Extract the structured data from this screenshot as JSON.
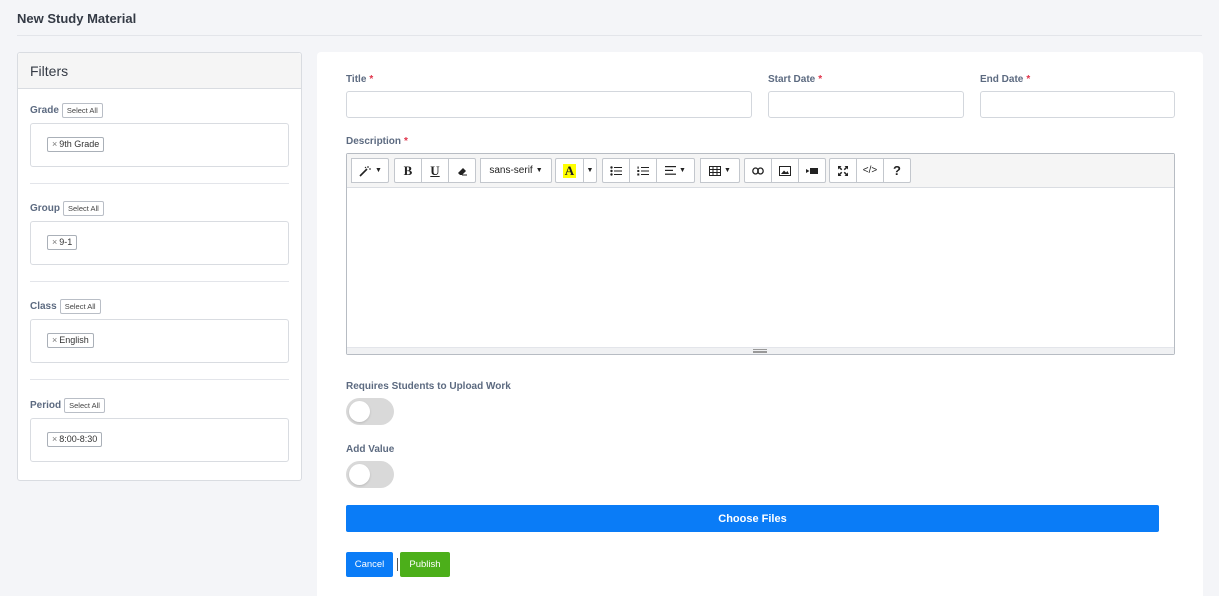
{
  "page": {
    "title": "New Study Material"
  },
  "filters": {
    "title": "Filters",
    "select_all_label": "Select All",
    "groups": [
      {
        "label": "Grade",
        "tags": [
          "9th Grade"
        ]
      },
      {
        "label": "Group",
        "tags": [
          "9-1"
        ]
      },
      {
        "label": "Class",
        "tags": [
          "English"
        ]
      },
      {
        "label": "Period",
        "tags": [
          "8:00-8:30"
        ]
      }
    ],
    "remove_symbol": "×"
  },
  "form": {
    "title_label": "Title",
    "start_date_label": "Start Date",
    "end_date_label": "End Date",
    "description_label": "Description",
    "required_marker": "*",
    "title_value": "",
    "start_date_value": "",
    "end_date_value": "",
    "upload_work_label": "Requires Students to Upload Work",
    "upload_work_on": false,
    "add_value_label": "Add Value",
    "add_value_on": false,
    "choose_files_label": "Choose Files",
    "cancel_label": "Cancel",
    "publish_label": "Publish"
  },
  "editor": {
    "bold": "B",
    "underline": "U",
    "font_name": "sans-serif",
    "highlight_letter": "A",
    "code_view": "</>",
    "help": "?",
    "highlight_color": "#ffff00"
  },
  "colors": {
    "primary": "#0a7cf7",
    "success": "#4caf1a",
    "required": "#e0334a"
  }
}
